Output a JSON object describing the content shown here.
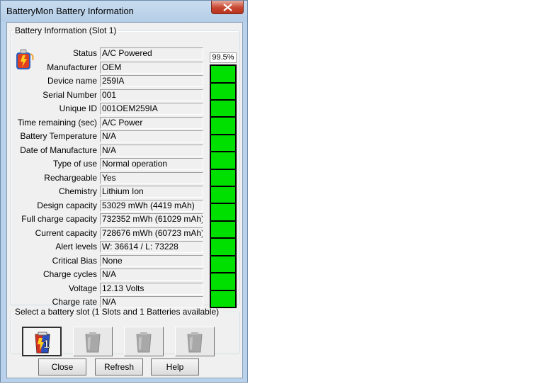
{
  "window": {
    "title": "BatteryMon Battery Information"
  },
  "info": {
    "legend": "Battery Information (Slot 1)",
    "percent": "99.5%",
    "rows": [
      {
        "label": "Status",
        "value": "A/C Powered"
      },
      {
        "label": "Manufacturer",
        "value": "OEM"
      },
      {
        "label": "Device name",
        "value": "259IA"
      },
      {
        "label": "Serial Number",
        "value": "001"
      },
      {
        "label": "Unique ID",
        "value": "001OEM259IA"
      },
      {
        "label": "Time remaining (sec)",
        "value": "A/C Power"
      },
      {
        "label": "Battery Temperature",
        "value": "N/A"
      },
      {
        "label": "Date of Manufacture",
        "value": "N/A"
      },
      {
        "label": "Type of use",
        "value": "Normal operation"
      },
      {
        "label": "Rechargeable",
        "value": "Yes"
      },
      {
        "label": "Chemistry",
        "value": "Lithium Ion"
      },
      {
        "label": "Design capacity",
        "value": "53029 mWh (4419 mAh)"
      },
      {
        "label": "Full charge capacity",
        "value": "732352 mWh (61029 mAh)"
      },
      {
        "label": "Current capacity",
        "value": "728676 mWh (60723 mAh)"
      },
      {
        "label": "Alert levels",
        "value": "W: 36614 / L: 73228"
      },
      {
        "label": "Critical Bias",
        "value": "None"
      },
      {
        "label": "Charge cycles",
        "value": "N/A"
      },
      {
        "label": "Voltage",
        "value": "12.13 Volts"
      },
      {
        "label": "Charge rate",
        "value": "N/A"
      }
    ],
    "charge_fraction": 0.995,
    "bar_color": "#00e000"
  },
  "slots": {
    "legend": "Select a battery slot (1 Slots and 1 Batteries available)",
    "items": [
      {
        "icon": "battery-slot-1-icon",
        "active": true,
        "number": "1"
      },
      {
        "icon": "battery-slot-empty-icon",
        "active": false
      },
      {
        "icon": "battery-slot-empty-icon",
        "active": false
      },
      {
        "icon": "battery-slot-empty-icon",
        "active": false
      }
    ]
  },
  "buttons": {
    "close": "Close",
    "refresh": "Refresh",
    "help": "Help"
  }
}
